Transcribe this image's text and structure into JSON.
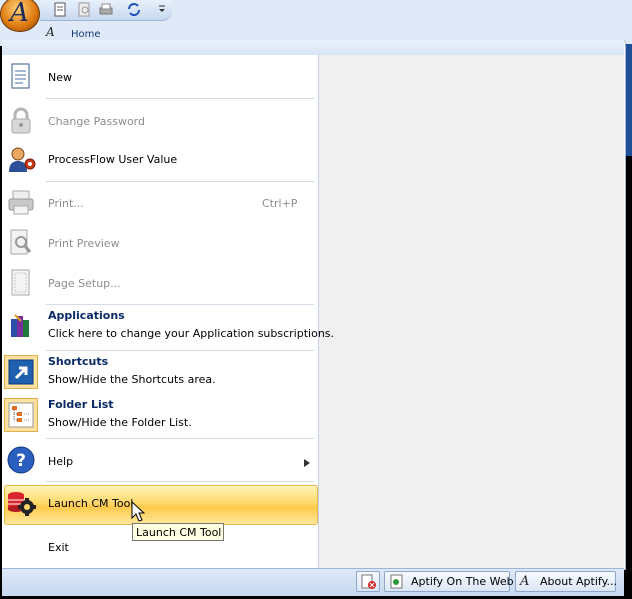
{
  "ribbon": {
    "home_tab": "Home",
    "orb_logo": "A"
  },
  "menu": {
    "items": [
      {
        "label": "New",
        "icon": "new-document-icon",
        "enabled": true
      },
      {
        "label": "Change Password",
        "icon": "lock-icon",
        "enabled": false
      },
      {
        "label": "ProcessFlow User Value",
        "icon": "user-processflow-icon",
        "enabled": true
      },
      {
        "label": "Print...",
        "shortcut": "Ctrl+P",
        "icon": "printer-icon",
        "enabled": false
      },
      {
        "label": "Print Preview",
        "icon": "print-preview-icon",
        "enabled": false
      },
      {
        "label": "Page Setup...",
        "icon": "page-setup-icon",
        "enabled": false
      },
      {
        "title": "Applications",
        "subtitle": "Click here to change your Application subscriptions.",
        "icon": "applications-books-icon",
        "enabled": true
      },
      {
        "title": "Shortcuts",
        "subtitle": "Show/Hide the Shortcuts area.",
        "icon": "shortcut-arrow-icon",
        "enabled": true
      },
      {
        "title": "Folder List",
        "subtitle": "Show/Hide the Folder List.",
        "icon": "folder-list-icon",
        "enabled": true
      },
      {
        "label": "Help",
        "icon": "help-question-icon",
        "enabled": true,
        "has_submenu": true
      },
      {
        "label": "Launch CM Tool",
        "icon": "cm-tool-gear-icon",
        "enabled": true,
        "highlighted": true
      },
      {
        "label": "Exit",
        "enabled": true
      }
    ]
  },
  "tooltip": "Launch CM Tool",
  "bottom_bar": {
    "aptify_web": "Aptify On The Web",
    "about": "About Aptify..."
  },
  "colors": {
    "highlight": "#ffd86a",
    "menu_border": "#9eb4d3",
    "title_text": "#0a2a66",
    "disabled_text": "#8e8e8e"
  }
}
